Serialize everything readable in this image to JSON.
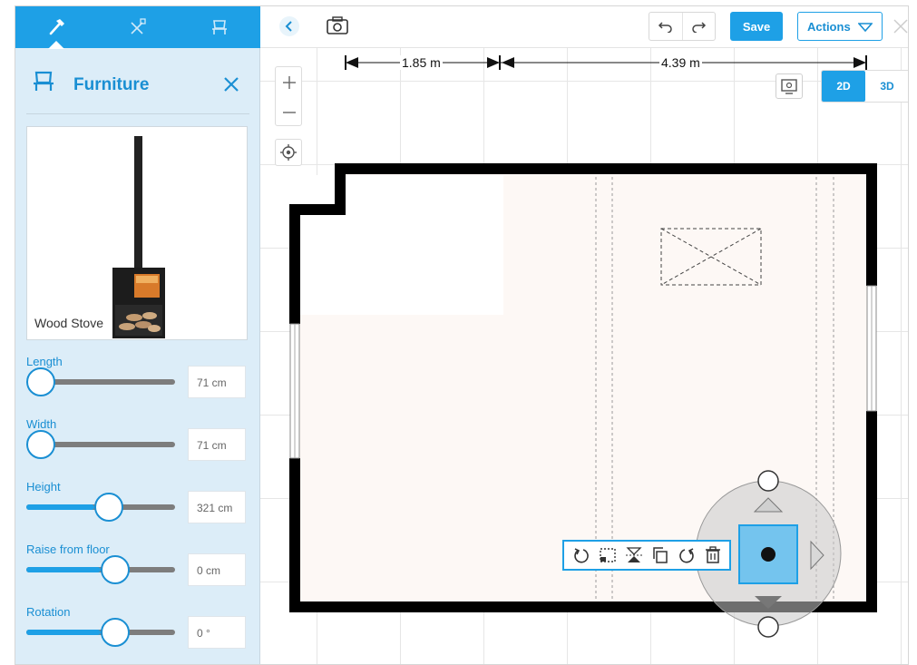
{
  "sidebar": {
    "tabs": [
      {
        "name": "build",
        "icon": "hammer-icon",
        "active": true
      },
      {
        "name": "decorate",
        "icon": "paint-tools-icon",
        "active": false
      },
      {
        "name": "furniture",
        "icon": "chair-icon",
        "active": false
      }
    ],
    "panel_title": "Furniture",
    "preview_name": "Wood Stove",
    "sliders": [
      {
        "label": "Length",
        "value": "71 cm",
        "level": 0.0
      },
      {
        "label": "Width",
        "value": "71 cm",
        "level": 0.0
      },
      {
        "label": "Height",
        "value": "321 cm",
        "level": 0.46
      },
      {
        "label": "Raise from floor",
        "value": "0 cm",
        "level": 0.5
      },
      {
        "label": "Rotation",
        "value": "0 °",
        "level": 0.5
      }
    ]
  },
  "toolbar": {
    "save_label": "Save",
    "actions_label": "Actions"
  },
  "view": {
    "btn_2d": "2D",
    "btn_3d": "3D",
    "active": "2D"
  },
  "dimensions": {
    "left": "1.85 m",
    "right": "4.39 m"
  },
  "colors": {
    "accent": "#1ea0e6",
    "sidebar_bg": "#dcedf8",
    "wall": "#000000",
    "floor": "#fdf8f5"
  }
}
